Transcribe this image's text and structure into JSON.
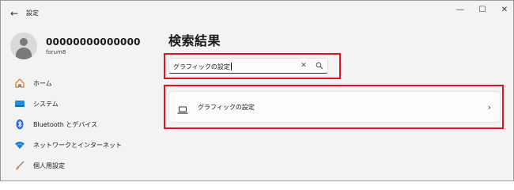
{
  "titlebar": {
    "app_title": "設定",
    "back_glyph": "←",
    "minimize_glyph": "—",
    "maximize_glyph": "☐",
    "close_glyph": "✕"
  },
  "profile": {
    "name": "00000000000000",
    "id": "forum8"
  },
  "sidebar": {
    "items": [
      {
        "label": "ホーム",
        "icon": "home-icon",
        "color": "#d3874a"
      },
      {
        "label": "システム",
        "icon": "system-icon",
        "color": "#1c8fd8"
      },
      {
        "label": "Bluetooth とデバイス",
        "icon": "bluetooth-icon",
        "color": "#1c6fd8"
      },
      {
        "label": "ネットワークとインターネット",
        "icon": "wifi-icon",
        "color": "#1c7fd8"
      },
      {
        "label": "個人用設定",
        "icon": "brush-icon",
        "color": "#c9844a"
      }
    ]
  },
  "main": {
    "title": "検索結果",
    "search": {
      "value": "グラフィックの設定",
      "clear_glyph": "✕"
    },
    "results": [
      {
        "label": "グラフィックの設定",
        "icon": "laptop-icon",
        "chevron": "›"
      }
    ]
  },
  "colors": {
    "highlight": "#e0141e",
    "window_bg": "#f3f3f3"
  }
}
